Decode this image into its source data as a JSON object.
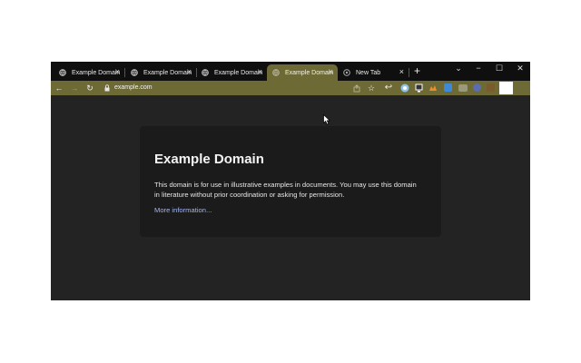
{
  "tabs": [
    {
      "label": "Example Domain",
      "close": "×",
      "active": false
    },
    {
      "label": "Example Domain",
      "close": "×",
      "active": false
    },
    {
      "label": "Example Domain",
      "close": "×",
      "active": false
    },
    {
      "label": "Example Domain",
      "close": "×",
      "active": true
    },
    {
      "label": "New Tab",
      "close": "×",
      "active": false
    }
  ],
  "new_tab_label": "+",
  "window_controls": {
    "menu": "⌄",
    "minimize": "−",
    "maximize": "☐",
    "close": "✕"
  },
  "toolbar": {
    "url": "example.com",
    "back": "←",
    "forward": "→",
    "reload": "↻"
  },
  "theme": {
    "accent": "#6e6a35",
    "page_bg": "#232323",
    "card_bg": "#1b1b1b",
    "link": "#a4b4f0"
  },
  "page": {
    "title": "Example Domain",
    "body": "This domain is for use in illustrative examples in documents. You may use this domain in literature without prior coordination or asking for permission.",
    "link": "More information..."
  }
}
